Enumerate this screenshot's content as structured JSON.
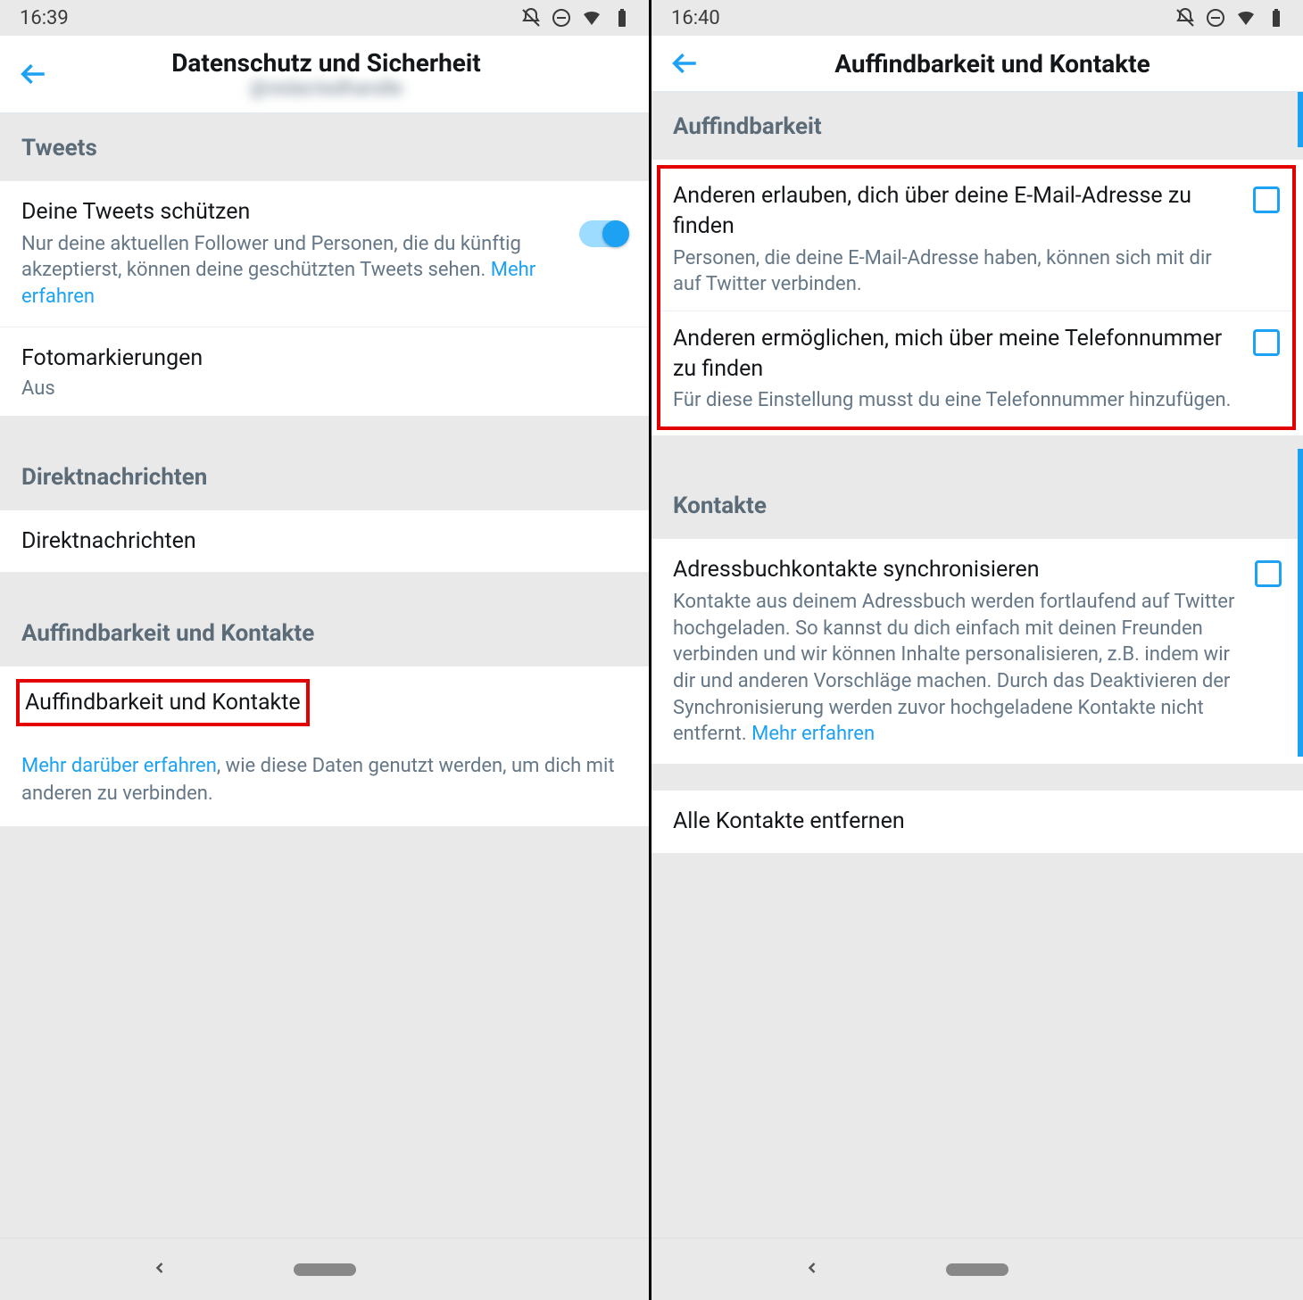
{
  "left": {
    "statusbar": {
      "time": "16:39"
    },
    "appbar": {
      "title": "Datenschutz und Sicherheit",
      "subtitle": "@redactedhandle"
    },
    "sections": {
      "tweets_header": "Tweets",
      "protect": {
        "title": "Deine Tweets schützen",
        "desc": "Nur deine aktuellen Follower und Personen, die du künftig akzeptierst, können deine geschützten Tweets sehen. ",
        "link": "Mehr erfahren",
        "toggle": true
      },
      "phototag": {
        "title": "Fotomarkierungen",
        "value": "Aus"
      },
      "dm_header": "Direktnachrichten",
      "dm_item": "Direktnachrichten",
      "discover_header": "Auffindbarkeit und Kontakte",
      "discover_item": "Auffindbarkeit und Kontakte",
      "footer_link": "Mehr darüber erfahren",
      "footer_rest": ", wie diese Daten genutzt werden, um dich mit anderen zu verbinden."
    }
  },
  "right": {
    "statusbar": {
      "time": "16:40"
    },
    "appbar": {
      "title": "Auffindbarkeit und Kontakte"
    },
    "sections": {
      "disc_header": "Auffindbarkeit",
      "email": {
        "title": "Anderen erlauben, dich über deine E-Mail-Adresse zu finden",
        "desc": "Personen, die deine E-Mail-Adresse haben, können sich mit dir auf Twitter verbinden.",
        "checked": false
      },
      "phone": {
        "title": "Anderen ermöglichen, mich über meine Telefonnummer zu finden",
        "desc": "Für diese Einstellung musst du eine Telefonnummer hinzufügen.",
        "checked": false
      },
      "contacts_header": "Kontakte",
      "sync": {
        "title": "Adressbuchkontakte synchronisieren",
        "desc": "Kontakte aus deinem Adressbuch werden fortlaufend auf Twitter hochgeladen. So kannst du dich einfach mit deinen Freunden verbinden und wir können Inhalte personalisieren, z.B. indem wir dir und anderen Vorschläge machen. Durch das Deaktivieren der Synchronisierung werden zuvor hochgeladene Kontakte nicht entfernt. ",
        "link": "Mehr erfahren",
        "checked": false
      },
      "remove_all": "Alle Kontakte entfernen"
    }
  }
}
